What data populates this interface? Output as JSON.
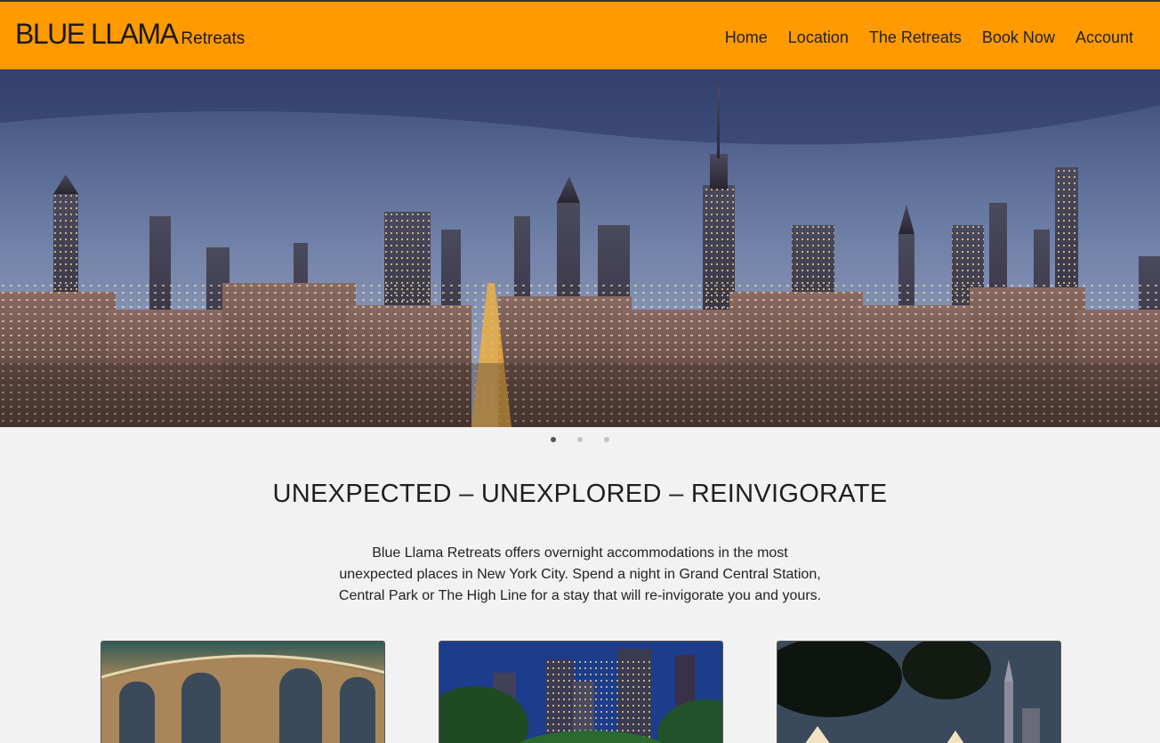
{
  "brand": {
    "main": "BLUE LLAMA",
    "sub": "Retreats"
  },
  "nav": {
    "items": [
      {
        "label": "Home"
      },
      {
        "label": "Location"
      },
      {
        "label": "The Retreats"
      },
      {
        "label": "Book Now"
      },
      {
        "label": "Account"
      }
    ]
  },
  "carousel": {
    "slide_count": 3,
    "active_index": 0
  },
  "main": {
    "headline": "UNEXPECTED – UNEXPLORED – REINVIGORATE",
    "intro_lines": [
      "Blue Llama Retreats offers overnight accommodations in the most",
      "unexpected places in New York City. Spend a night in Grand Central Station,",
      "Central Park or The High Line for a stay that will re-invigorate you and yours."
    ]
  },
  "colors": {
    "navbar": "#ff9a00",
    "page_bg": "#f2f2f2"
  }
}
